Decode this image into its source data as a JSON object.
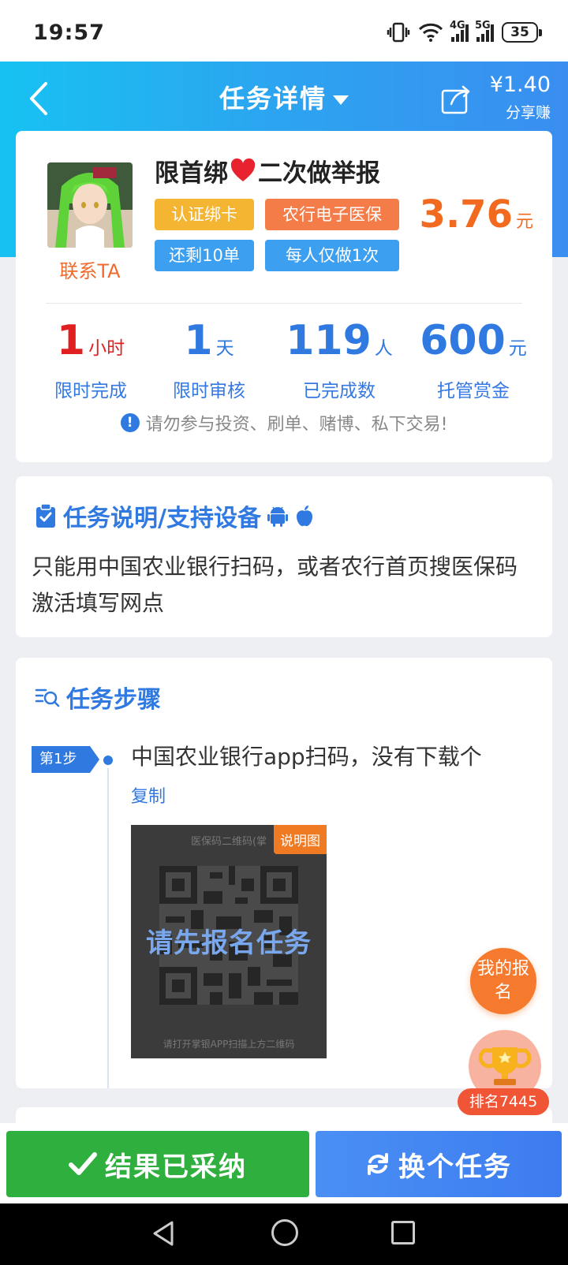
{
  "status_bar": {
    "time": "19:57",
    "signal_4g": "4G",
    "signal_5g": "5G",
    "battery": "35"
  },
  "header": {
    "title": "任务详情",
    "share_amount": "¥1.40",
    "share_label": "分享赚"
  },
  "task": {
    "title_part1": "限首绑",
    "title_part2": "二次做举报",
    "contact_label": "联系TA",
    "tags": [
      "认证绑卡",
      "农行电子医保",
      "还剩10单",
      "每人仅做1次"
    ],
    "price": "3.76",
    "price_unit": "元",
    "stats": [
      {
        "value": "1",
        "unit": "小时",
        "label": "限时完成"
      },
      {
        "value": "1",
        "unit": "天",
        "label": "限时审核"
      },
      {
        "value": "119",
        "unit": "人",
        "label": "已完成数"
      },
      {
        "value": "600",
        "unit": "元",
        "label": "托管赏金"
      }
    ],
    "warning": "请勿参与投资、刷单、赌博、私下交易!"
  },
  "description": {
    "title": "任务说明/支持设备",
    "text": "只能用中国农业银行扫码，或者农行首页搜医保码激活填写网点"
  },
  "steps": {
    "title": "任务步骤",
    "items": [
      {
        "badge": "第1步",
        "text": "中国农业银行app扫码，没有下载个",
        "copy_label": "复制",
        "image_tag": "说明图",
        "image_top_text": "医保码二维码(掌",
        "image_bottom_text": "请打开掌银APP扫描上方二维码",
        "image_overlay": "请先报名任务"
      }
    ]
  },
  "floating": {
    "my_signup": "我的报名",
    "rank": "排名7445"
  },
  "actions": {
    "accept": "结果已采纳",
    "switch": "换个任务"
  },
  "colors": {
    "accent_blue": "#2f79e0",
    "price_orange": "#f26a1f",
    "accept_green": "#2faf3d"
  }
}
